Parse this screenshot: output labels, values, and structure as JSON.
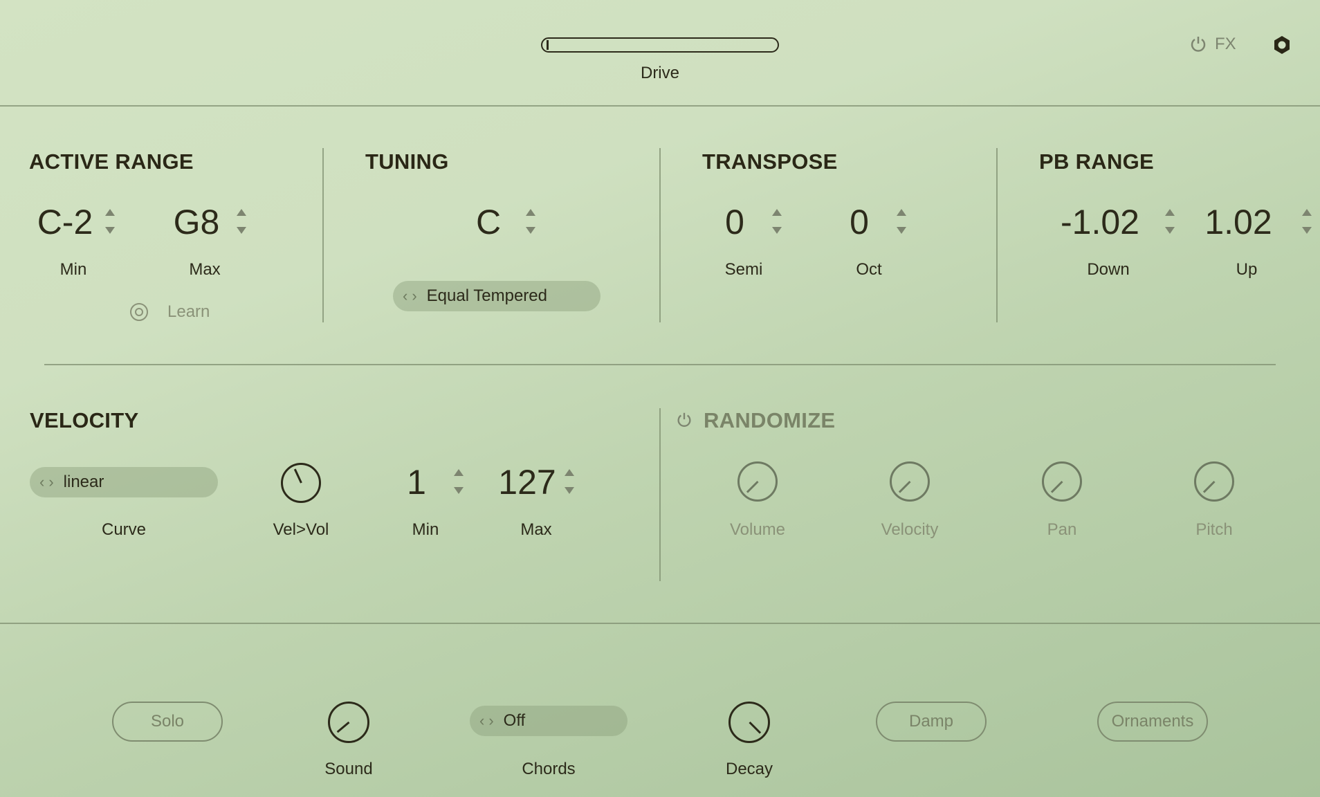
{
  "header": {
    "drive_label": "Drive",
    "fx_label": "FX"
  },
  "active_range": {
    "title": "ACTIVE RANGE",
    "min_value": "C-2",
    "max_value": "G8",
    "min_label": "Min",
    "max_label": "Max",
    "learn_label": "Learn"
  },
  "tuning": {
    "title": "TUNING",
    "key_value": "C",
    "scale": "Equal Tempered"
  },
  "transpose": {
    "title": "TRANSPOSE",
    "semi_value": "0",
    "oct_value": "0",
    "semi_label": "Semi",
    "oct_label": "Oct"
  },
  "pb_range": {
    "title": "PB RANGE",
    "down_value": "-1.02",
    "up_value": "1.02",
    "down_label": "Down",
    "up_label": "Up"
  },
  "velocity": {
    "title": "VELOCITY",
    "curve_value": "linear",
    "curve_label": "Curve",
    "velvol_label": "Vel>Vol",
    "min_value": "1",
    "max_value": "127",
    "min_label": "Min",
    "max_label": "Max"
  },
  "randomize": {
    "title": "RANDOMIZE",
    "knobs": [
      "Volume",
      "Velocity",
      "Pan",
      "Pitch"
    ]
  },
  "bottom": {
    "solo_label": "Solo",
    "sound_label": "Sound",
    "chords_value": "Off",
    "chords_label": "Chords",
    "decay_label": "Decay",
    "damp_label": "Damp",
    "ornaments_label": "Ornaments"
  },
  "colors": {
    "text": "#2c2a1a",
    "dim_text": "#8a9278",
    "background": "#cfe0c0"
  }
}
